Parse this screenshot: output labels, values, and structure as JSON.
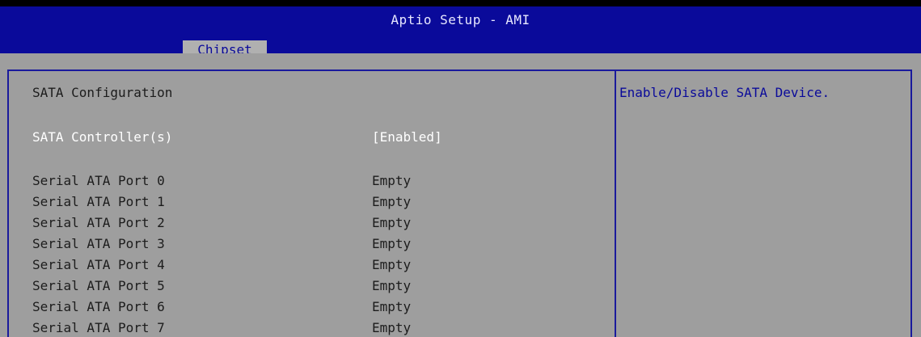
{
  "header": {
    "title": "Aptio Setup - AMI",
    "active_tab": "Chipset"
  },
  "main": {
    "section_title": "SATA Configuration",
    "controller": {
      "label": "SATA Controller(s)",
      "value": "[Enabled]"
    },
    "ports": [
      {
        "label": "Serial ATA Port 0",
        "value": "Empty"
      },
      {
        "label": "Serial ATA Port 1",
        "value": "Empty"
      },
      {
        "label": "Serial ATA Port 2",
        "value": "Empty"
      },
      {
        "label": "Serial ATA Port 3",
        "value": "Empty"
      },
      {
        "label": "Serial ATA Port 4",
        "value": "Empty"
      },
      {
        "label": "Serial ATA Port 5",
        "value": "Empty"
      },
      {
        "label": "Serial ATA Port 6",
        "value": "Empty"
      },
      {
        "label": "Serial ATA Port 7",
        "value": "Empty"
      }
    ]
  },
  "help_panel": {
    "text": "Enable/Disable SATA Device."
  },
  "colors": {
    "header_bg": "#0a0a9a",
    "body_bg": "#9e9e9e",
    "tab_bg": "#b0b0b0",
    "border": "#1a1a9c",
    "help_text": "#0a0a9a",
    "selected_text": "#ffffff"
  }
}
